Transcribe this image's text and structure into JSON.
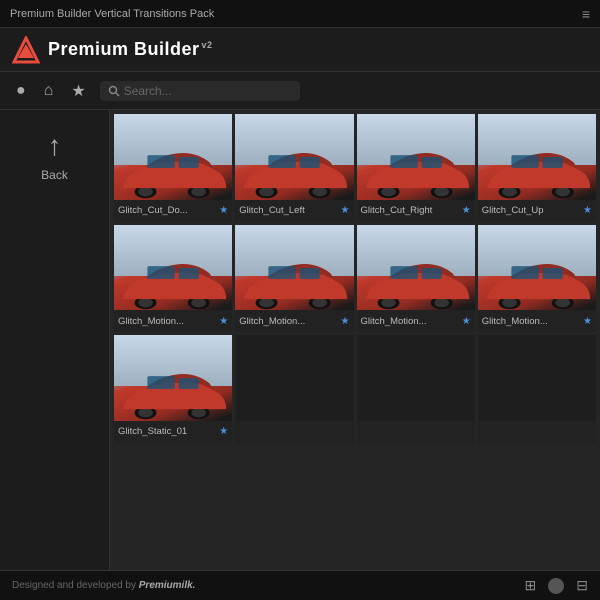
{
  "titleBar": {
    "text": "Premium Builder Vertical Transitions Pack",
    "menuIcon": "≡"
  },
  "header": {
    "logoText": "Premium Builder",
    "version": "v2"
  },
  "toolbar": {
    "circleBtn": "●",
    "homeBtn": "⌂",
    "starBtn": "★",
    "searchPlaceholder": "Search..."
  },
  "sidebar": {
    "backLabel": "Back"
  },
  "grid": {
    "row1": [
      {
        "label": "Glitch_Cut_Do...",
        "starred": true
      },
      {
        "label": "Glitch_Cut_Left",
        "starred": true
      },
      {
        "label": "Glitch_Cut_Right",
        "starred": true
      },
      {
        "label": "Glitch_Cut_Up",
        "starred": true
      }
    ],
    "row2": [
      {
        "label": "Glitch_Motion...",
        "starred": true
      },
      {
        "label": "Glitch_Motion...",
        "starred": true
      },
      {
        "label": "Glitch_Motion...",
        "starred": true
      },
      {
        "label": "Glitch_Motion...",
        "starred": true
      }
    ],
    "row3item5": {
      "label": "Glitch_Static_01",
      "starred": true
    },
    "row3": [
      {
        "label": "",
        "empty": true
      },
      {
        "label": "",
        "empty": true
      },
      {
        "label": "",
        "empty": true
      }
    ]
  },
  "bottomBar": {
    "creditText": "Designed and developed by",
    "brandName": "Premiumilk.",
    "gridIcon1": "⊞",
    "gridIcon2": "⊟"
  }
}
